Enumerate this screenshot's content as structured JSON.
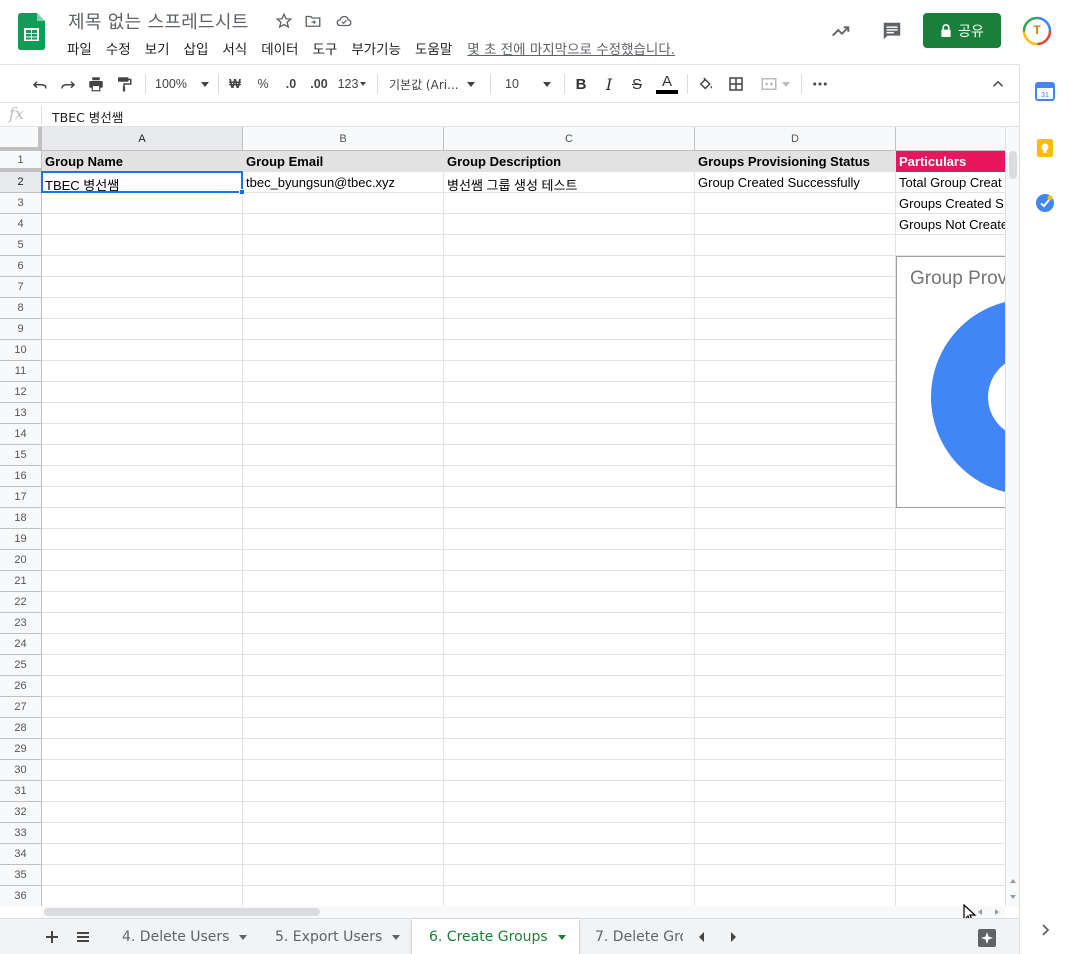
{
  "header": {
    "doc_title": "제목 없는 스프레드시트",
    "menu": [
      "파일",
      "수정",
      "보기",
      "삽입",
      "서식",
      "데이터",
      "도구",
      "부가기능",
      "도움말"
    ],
    "last_edit": "몇 초 전에 마지막으로 수정했습니다.",
    "share_label": "공유",
    "avatar_letter": "T"
  },
  "toolbar": {
    "zoom": "100%",
    "currency": "₩",
    "percent": "%",
    "dec_decrease": ".0",
    "dec_increase": ".00",
    "more_formats": "123",
    "font": "기본값 (Ari...",
    "font_size": "10",
    "bold": "B",
    "italic": "I",
    "strike": "S",
    "text_color": "A"
  },
  "formula_bar": {
    "fx": "fx",
    "value": "TBEC 병선쌤"
  },
  "columns": [
    "A",
    "B",
    "C",
    "D"
  ],
  "rows": [
    "1",
    "2",
    "3",
    "4",
    "5",
    "6",
    "7",
    "8",
    "9",
    "10",
    "11",
    "12",
    "13",
    "14",
    "15",
    "16",
    "17",
    "18",
    "19",
    "20",
    "21",
    "22",
    "23",
    "24",
    "25",
    "26",
    "27",
    "28",
    "29",
    "30",
    "31",
    "32",
    "33",
    "34",
    "35",
    "36"
  ],
  "cells": {
    "A1": "Group Name",
    "B1": "Group Email",
    "C1": "Group Description",
    "D1": "Groups Provisioning Status",
    "E1": "Particulars",
    "A2": "TBEC 병선쌤",
    "B2": "tbec_byungsun@tbec.xyz",
    "C2": "병선쌤 그룹 생성 테스트",
    "D2": "Group Created Successfully",
    "E2": "Total Group Creat",
    "E3": "Groups Created S",
    "E4": "Groups Not Create"
  },
  "chart": {
    "title": "Group Prov",
    "donut_color": "#4285f4"
  },
  "sheet_tabs": [
    {
      "label": "4. Delete Users",
      "active": false
    },
    {
      "label": "5. Export Users",
      "active": false
    },
    {
      "label": "6. Create Groups",
      "active": true
    },
    {
      "label": "7. Delete Gro",
      "active": false
    }
  ],
  "colors": {
    "brand_green": "#188038",
    "header_fill": "#e2e2e2",
    "particulars_fill": "#e8175d",
    "selection": "#1a73e8"
  },
  "icons": {
    "header": [
      "star-icon",
      "move-to-folder-icon",
      "cloud-saved-icon",
      "trending-icon",
      "comment-icon",
      "lock-icon"
    ],
    "toolbar": [
      "undo-icon",
      "redo-icon",
      "print-icon",
      "paint-format-icon",
      "fill-color-icon",
      "borders-icon",
      "merge-cells-icon",
      "more-icon",
      "collapse-icon"
    ],
    "side": [
      "calendar-icon",
      "keep-icon",
      "tasks-icon",
      "expand-panel-icon"
    ],
    "tabs": [
      "add-sheet-icon",
      "all-sheets-icon",
      "scroll-left-icon",
      "scroll-right-icon",
      "explore-icon"
    ]
  }
}
